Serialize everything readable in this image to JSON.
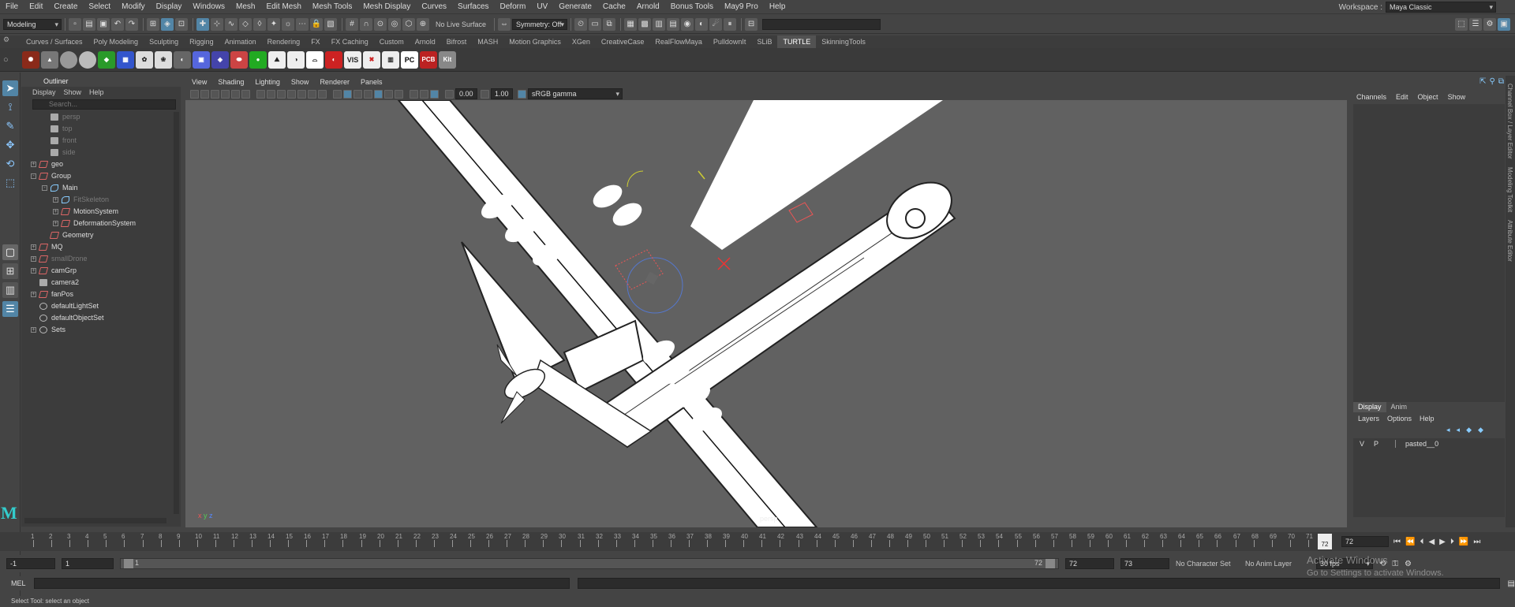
{
  "menubar": {
    "items": [
      "File",
      "Edit",
      "Create",
      "Select",
      "Modify",
      "Display",
      "Windows",
      "Mesh",
      "Edit Mesh",
      "Mesh Tools",
      "Mesh Display",
      "Curves",
      "Surfaces",
      "Deform",
      "UV",
      "Generate",
      "Cache",
      "Arnold",
      "Bonus Tools",
      "May9 Pro",
      "Help"
    ],
    "workspace_label": "Workspace :",
    "workspace_value": "Maya Classic"
  },
  "statusline": {
    "mode": "Modeling",
    "live_surface": "No Live Surface",
    "symmetry": "Symmetry: Off"
  },
  "shelf": {
    "tabs": [
      "Curves / Surfaces",
      "Poly Modeling",
      "Sculpting",
      "Rigging",
      "Animation",
      "Rendering",
      "FX",
      "FX Caching",
      "Custom",
      "Arnold",
      "Bifrost",
      "MASH",
      "Motion Graphics",
      "XGen",
      "CreativeCase",
      "RealFlowMaya",
      "PulldownIt",
      "SLiB",
      "TURTLE",
      "SkinningTools"
    ],
    "active_tab": "TURTLE",
    "icon_labels": [
      "VIS",
      "PCB",
      "Kit"
    ]
  },
  "outliner": {
    "title": "Outliner",
    "menu": [
      "Display",
      "Show",
      "Help"
    ],
    "search_placeholder": "Search...",
    "nodes": [
      {
        "label": "persp",
        "dim": true,
        "indent": 1,
        "icon": "cam",
        "exp": ""
      },
      {
        "label": "top",
        "dim": true,
        "indent": 1,
        "icon": "cam",
        "exp": ""
      },
      {
        "label": "front",
        "dim": true,
        "indent": 1,
        "icon": "cam",
        "exp": ""
      },
      {
        "label": "side",
        "dim": true,
        "indent": 1,
        "icon": "cam",
        "exp": ""
      },
      {
        "label": "geo",
        "dim": false,
        "indent": 0,
        "icon": "grp",
        "exp": "+"
      },
      {
        "label": "Group",
        "dim": false,
        "indent": 0,
        "icon": "grp",
        "exp": "-"
      },
      {
        "label": "Main",
        "dim": false,
        "indent": 1,
        "icon": "curve",
        "exp": "-"
      },
      {
        "label": "FitSkeleton",
        "dim": true,
        "indent": 2,
        "icon": "curve",
        "exp": "+"
      },
      {
        "label": "MotionSystem",
        "dim": false,
        "indent": 2,
        "icon": "grp",
        "exp": "+"
      },
      {
        "label": "DeformationSystem",
        "dim": false,
        "indent": 2,
        "icon": "grp",
        "exp": "+"
      },
      {
        "label": "Geometry",
        "dim": false,
        "indent": 1,
        "icon": "grp",
        "exp": ""
      },
      {
        "label": "MQ",
        "dim": false,
        "indent": 0,
        "icon": "grp",
        "exp": "+"
      },
      {
        "label": "smallDrone",
        "dim": true,
        "indent": 0,
        "icon": "grp",
        "exp": "+"
      },
      {
        "label": "camGrp",
        "dim": false,
        "indent": 0,
        "icon": "grp",
        "exp": "+"
      },
      {
        "label": "camera2",
        "dim": false,
        "indent": 0,
        "icon": "cam",
        "exp": ""
      },
      {
        "label": "fanPos",
        "dim": false,
        "indent": 0,
        "icon": "grp",
        "exp": "+"
      },
      {
        "label": "defaultLightSet",
        "dim": false,
        "indent": 0,
        "icon": "set",
        "exp": ""
      },
      {
        "label": "defaultObjectSet",
        "dim": false,
        "indent": 0,
        "icon": "set",
        "exp": ""
      },
      {
        "label": "Sets",
        "dim": false,
        "indent": 0,
        "icon": "set",
        "exp": "+"
      }
    ]
  },
  "viewport": {
    "menu": [
      "View",
      "Shading",
      "Lighting",
      "Show",
      "Renderer",
      "Panels"
    ],
    "exposure": "0.00",
    "gamma": "1.00",
    "color_space": "sRGB gamma",
    "camera_label": "persp"
  },
  "channelbox": {
    "menu": [
      "Channels",
      "Edit",
      "Object",
      "Show"
    ],
    "layer_tabs": [
      "Display",
      "Anim"
    ],
    "layer_menu": [
      "Layers",
      "Options",
      "Help"
    ],
    "layer_row": {
      "v": "V",
      "p": "P",
      "name": "pasted__0"
    },
    "side_tabs": [
      "Channel Box / Layer Editor",
      "Modeling Toolkit",
      "Attribute Editor"
    ]
  },
  "timeline": {
    "tick_labels": [
      "1",
      "2",
      "3",
      "4",
      "5",
      "6",
      "7",
      "8",
      "9",
      "10",
      "11",
      "12",
      "13",
      "14",
      "15",
      "16",
      "17",
      "18",
      "19",
      "20",
      "21",
      "22",
      "23",
      "24",
      "25",
      "26",
      "27",
      "28",
      "29",
      "30",
      "31",
      "32",
      "33",
      "34",
      "35",
      "36",
      "37",
      "38",
      "39",
      "40",
      "41",
      "42",
      "43",
      "44",
      "45",
      "46",
      "47",
      "48",
      "49",
      "50",
      "51",
      "52",
      "53",
      "54",
      "55",
      "56",
      "57",
      "58",
      "59",
      "60",
      "61",
      "62",
      "63",
      "64",
      "65",
      "66",
      "67",
      "68",
      "69",
      "70",
      "71",
      "72"
    ],
    "current_frame_marker": "72",
    "current_frame": "72"
  },
  "range": {
    "start_outer": "-1",
    "start_inner": "1",
    "slider_start": "1",
    "slider_end": "72",
    "end_inner": "72",
    "end_outer": "73",
    "character_set": "No Character Set",
    "anim_layer": "No Anim Layer",
    "fps": "30 fps"
  },
  "cmd": {
    "lang": "MEL"
  },
  "help_line": "Select Tool: select an object",
  "watermark": {
    "line1": "Activate Windows",
    "line2": "Go to Settings to activate Windows."
  },
  "colors": {
    "accent": "#5285a6",
    "viewport_bg": "#616161",
    "panel_bg": "#444444"
  }
}
